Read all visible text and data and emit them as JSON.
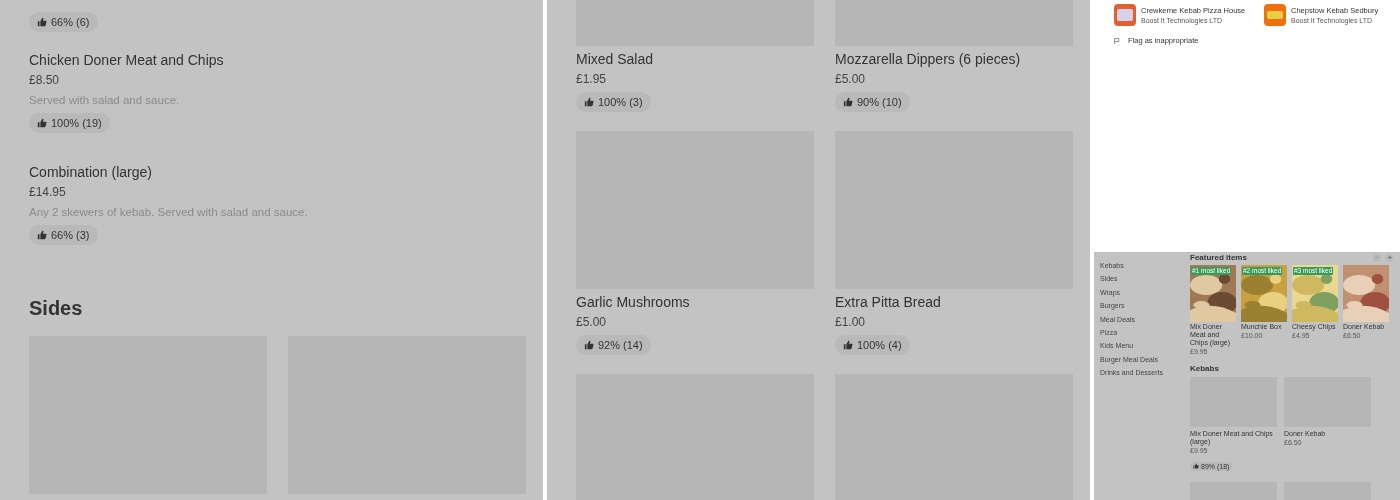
{
  "left_panel": {
    "top_rating": "66% (6)",
    "items": [
      {
        "name": "Chicken Doner Meat and Chips",
        "price": "£8.50",
        "description": "Served with salad and sauce.",
        "rating": "100% (19)"
      },
      {
        "name": "Combination (large)",
        "price": "£14.95",
        "description": "Any 2 skewers of kebab. Served with salad and sauce.",
        "rating": "66% (3)"
      }
    ],
    "section": {
      "title": "Sides",
      "tiles": [
        {
          "kind": "placeholder"
        },
        {
          "kind": "placeholder"
        }
      ]
    }
  },
  "middle_panel": {
    "rows": [
      {
        "items": [
          {
            "name": "Mixed Salad",
            "price": "£1.95",
            "rating": "100% (3)"
          },
          {
            "name": "Mozzarella Dippers (6 pieces)",
            "price": "£5.00",
            "rating": "90% (10)"
          }
        ]
      },
      {
        "items": [
          {
            "name": "Garlic Mushrooms",
            "price": "£5.00",
            "rating": "92% (14)"
          },
          {
            "name": "Extra Pitta Bread",
            "price": "£1.00",
            "rating": "100% (4)"
          }
        ]
      }
    ]
  },
  "right_panel": {
    "related_apps": [
      {
        "name": "Crewkerne Kebab Pizza House",
        "developer": "Boost It Technologies LTD"
      },
      {
        "name": "Chepstow Kebab Sedbury",
        "developer": "Boost It Technologies LTD"
      }
    ],
    "flag_link": "Flag as inappropriate",
    "sidebar": [
      "Kebabs",
      "Sides",
      "Wraps",
      "Burgers",
      "Meal Deals",
      "Pizza",
      "Kids Menu",
      "Burger Meal Deals",
      "Drinks and Desserts"
    ],
    "featured": {
      "title": "Featured items",
      "items": [
        {
          "badge": "#1 most liked",
          "name": "Mix Doner Meat and Chips (large)",
          "price": "£9.95"
        },
        {
          "badge": "#2 most liked",
          "name": "Munchie Box",
          "price": "£10.00"
        },
        {
          "badge": "#3 most liked",
          "name": "Cheesy Chips",
          "price": "£4.95"
        },
        {
          "name": "Doner Kebab",
          "price": "£6.50"
        }
      ]
    },
    "kebabs": {
      "title": "Kebabs",
      "items": [
        {
          "name": "Mix Doner Meat and Chips (large)",
          "price": "£9.95",
          "rating": "89% (18)"
        },
        {
          "name": "Doner Kebab",
          "price": "£6.50"
        }
      ]
    }
  }
}
